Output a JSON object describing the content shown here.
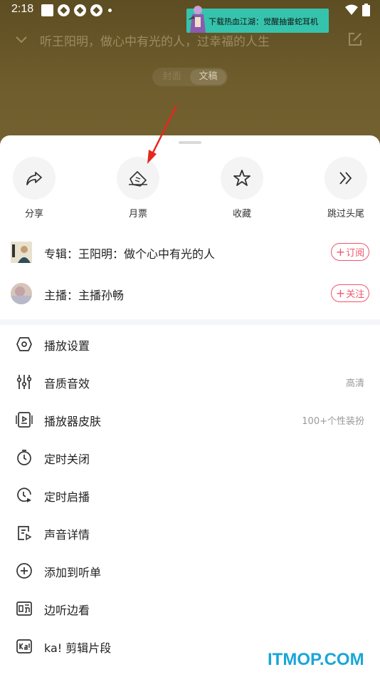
{
  "status_bar": {
    "time": "2:18"
  },
  "ad": {
    "text": "下载热血江湖：觉醒抽雷蛇耳机"
  },
  "player": {
    "title": "听王阳明，做心中有光的人，过幸福的人生"
  },
  "segment": {
    "cover": "封面",
    "transcript": "文稿"
  },
  "actions": [
    {
      "label": "分享",
      "icon": "share-icon"
    },
    {
      "label": "月票",
      "icon": "monthly-ticket-icon"
    },
    {
      "label": "收藏",
      "icon": "star-icon"
    },
    {
      "label": "跳过头尾",
      "icon": "skip-icon"
    }
  ],
  "album": {
    "text": "专辑：王阳明：做个心中有光的人",
    "button": "订阅",
    "plus": "+"
  },
  "host": {
    "text": "主播：主播孙畅",
    "button": "关注",
    "plus": "+"
  },
  "menu": [
    {
      "label": "播放设置",
      "extra": "",
      "icon": "play-settings-icon"
    },
    {
      "label": "音质音效",
      "extra": "高清",
      "icon": "equalizer-icon"
    },
    {
      "label": "播放器皮肤",
      "extra": "100+个性装扮",
      "icon": "skin-icon"
    },
    {
      "label": "定时关闭",
      "extra": "",
      "icon": "timer-off-icon"
    },
    {
      "label": "定时启播",
      "extra": "",
      "icon": "timer-start-icon"
    },
    {
      "label": "声音详情",
      "extra": "",
      "icon": "detail-icon"
    },
    {
      "label": "添加到听单",
      "extra": "",
      "icon": "add-list-icon"
    },
    {
      "label": "边听边看",
      "extra": "",
      "icon": "listen-read-icon"
    },
    {
      "label": "ka! 剪辑片段",
      "extra": "",
      "icon": "clip-icon"
    }
  ],
  "watermark": "ITMOP.COM",
  "colors": {
    "accent": "#f0556a",
    "sheet_bg": "#ffffff",
    "player_bg": "#6b5a2c",
    "watermark": "#1aa6d8"
  }
}
